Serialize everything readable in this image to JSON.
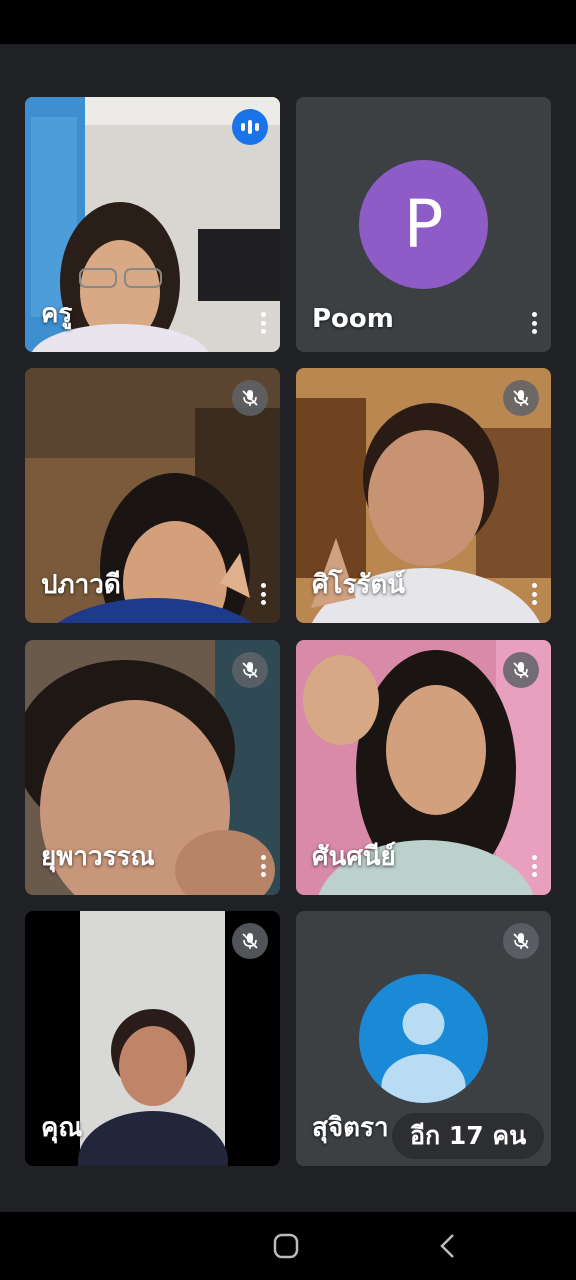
{
  "participants": [
    {
      "name": "ครู",
      "state": "speaking"
    },
    {
      "name": "Poom",
      "avatar_letter": "P",
      "avatar_color": "#8e5cc6",
      "state": "camera-off"
    },
    {
      "name": "ปภาวดี",
      "state": "muted"
    },
    {
      "name": "ศิโรรัตน์",
      "state": "muted"
    },
    {
      "name": "ยุพาวรรณ",
      "state": "muted"
    },
    {
      "name": "ศันศนีย์",
      "state": "muted"
    },
    {
      "name": "คุณ",
      "state": "muted"
    },
    {
      "name": "สุจิตรา",
      "state": "muted",
      "avatar_color": "#1a8ad6"
    }
  ],
  "overflow_chip": {
    "label": "อีก 17 คน"
  },
  "colors": {
    "background": "#202124",
    "tile": "#3c4043",
    "speaking": "#1a73e8"
  },
  "icons": [
    "speaking-indicator-icon",
    "mic-off-icon",
    "more-vert-icon",
    "person-icon",
    "home-icon",
    "back-icon"
  ]
}
